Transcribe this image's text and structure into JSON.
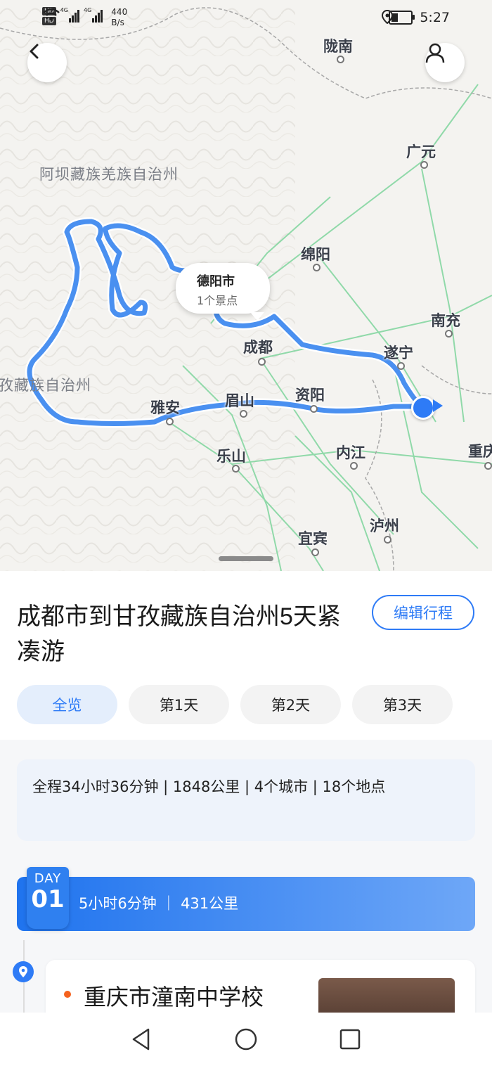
{
  "status_bar": {
    "hd_badge_1": "HD",
    "hd_badge_2": "HD",
    "net_1": "4G",
    "net_2": "4G",
    "speed_value": "440",
    "speed_unit": "B/s",
    "time": "5:27",
    "battery_level": 0.35
  },
  "map": {
    "cities": [
      {
        "name": "陇南"
      },
      {
        "name": "广元"
      },
      {
        "name": "绵阳"
      },
      {
        "name": "南充"
      },
      {
        "name": "成都"
      },
      {
        "name": "遂宁"
      },
      {
        "name": "雅安"
      },
      {
        "name": "眉山"
      },
      {
        "name": "资阳"
      },
      {
        "name": "乐山"
      },
      {
        "name": "内江"
      },
      {
        "name": "泸州"
      },
      {
        "name": "宜宾"
      },
      {
        "name": "重庆"
      }
    ],
    "regions": [
      {
        "name": "阿坝藏族羌族自治州"
      },
      {
        "name": "孜藏族自治州"
      }
    ],
    "tooltip": {
      "title": "德阳市",
      "subtitle": "1个景点"
    },
    "icons": {
      "back": "chevron-left-icon",
      "profile": "user-icon"
    }
  },
  "trip": {
    "title": "成都市到甘孜藏族自治州5天紧凑游",
    "edit_label": "编辑行程",
    "tabs": [
      {
        "label": "全览"
      },
      {
        "label": "第1天"
      },
      {
        "label": "第2天"
      },
      {
        "label": "第3天"
      }
    ],
    "summary": "全程34小时36分钟 | 1848公里 | 4个城市 | 18个地点",
    "day": {
      "badge_label": "DAY",
      "badge_number": "01",
      "info": "5小时6分钟 ｜ 431公里"
    },
    "first_stop": {
      "name": "重庆市潼南中学校"
    }
  },
  "colors": {
    "accent": "#2e7bf6",
    "route": "#4a90f0",
    "orange": "#f5621e"
  }
}
